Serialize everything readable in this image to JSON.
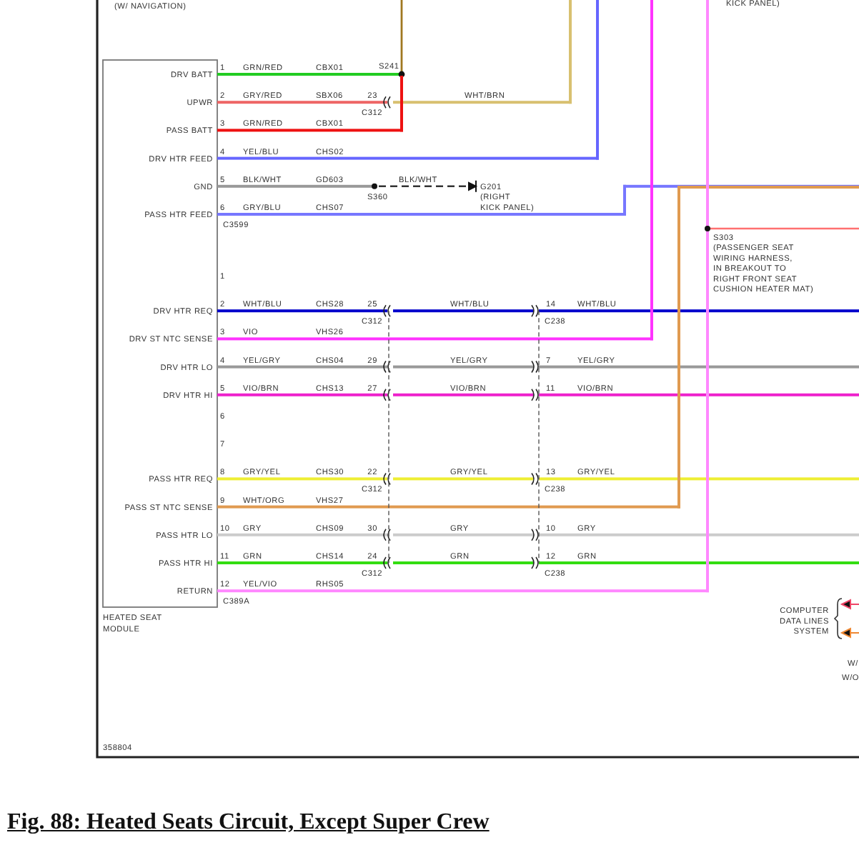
{
  "notes": {
    "top_left": "(W/ NAVIGATION)",
    "top_right": "KICK PANEL)"
  },
  "module": {
    "name_lines": [
      "HEATED SEAT",
      "MODULE"
    ]
  },
  "connectors": [
    {
      "name": "C3599",
      "pins": [
        {
          "pin": "1",
          "label": "DRV BATT",
          "wire": "GRN/RED",
          "circuit": "CBX01",
          "kind": "splice",
          "splice": "S241",
          "color": "#22cc22"
        },
        {
          "pin": "2",
          "label": "UPWR",
          "wire": "GRY/RED",
          "circuit": "SBX06",
          "kind": "inline_riser",
          "c312": {
            "cavity": "23",
            "connector": "C312"
          },
          "out": {
            "wire": "WHT/BRN",
            "color": "#d8c070"
          },
          "color": "#ee6666"
        },
        {
          "pin": "3",
          "label": "PASS BATT",
          "wire": "GRN/RED",
          "circuit": "CBX01",
          "kind": "splice_join",
          "color": "#ee1111"
        },
        {
          "pin": "4",
          "label": "DRV HTR FEED",
          "wire": "YEL/BLU",
          "circuit": "CHS02",
          "kind": "riser",
          "color": "#6666ff"
        },
        {
          "pin": "5",
          "label": "GND",
          "wire": "BLK/WHT",
          "circuit": "GD603",
          "kind": "ground",
          "splice": "S360",
          "out_wire": "BLK/WHT",
          "ground": [
            "G201",
            "(RIGHT",
            "KICK PANEL)"
          ],
          "color": "#999999"
        },
        {
          "pin": "6",
          "label": "PASS HTR FEED",
          "wire": "GRY/BLU",
          "circuit": "CHS07",
          "kind": "jog",
          "color": "#7777ff"
        }
      ]
    },
    {
      "name": "C389A",
      "pins": [
        {
          "pin": "1",
          "kind": "none"
        },
        {
          "pin": "2",
          "label": "DRV HTR REQ",
          "wire": "WHT/BLU",
          "circuit": "CHS28",
          "kind": "through",
          "c312": {
            "cavity": "25",
            "connector": "C312"
          },
          "out_wire": "WHT/BLU",
          "c238": {
            "cavity": "14",
            "connector": "C238"
          },
          "out2_wire": "WHT/BLU",
          "color": "#0000cc"
        },
        {
          "pin": "3",
          "label": "DRV ST NTC SENSE",
          "wire": "VIO",
          "circuit": "VHS26",
          "kind": "riser",
          "color": "#ff33ff"
        },
        {
          "pin": "4",
          "label": "DRV HTR LO",
          "wire": "YEL/GRY",
          "circuit": "CHS04",
          "kind": "through",
          "c312": {
            "cavity": "29"
          },
          "out_wire": "YEL/GRY",
          "c238": {
            "cavity": "7"
          },
          "out2_wire": "YEL/GRY",
          "color": "#999999"
        },
        {
          "pin": "5",
          "label": "DRV HTR HI",
          "wire": "VIO/BRN",
          "circuit": "CHS13",
          "kind": "through",
          "c312": {
            "cavity": "27"
          },
          "out_wire": "VIO/BRN",
          "c238": {
            "cavity": "11"
          },
          "out2_wire": "VIO/BRN",
          "color": "#ee22cc"
        },
        {
          "pin": "6",
          "kind": "none"
        },
        {
          "pin": "7",
          "kind": "none"
        },
        {
          "pin": "8",
          "label": "PASS HTR REQ",
          "wire": "GRY/YEL",
          "circuit": "CHS30",
          "kind": "through",
          "c312": {
            "cavity": "22",
            "connector": "C312"
          },
          "out_wire": "GRY/YEL",
          "c238": {
            "cavity": "13",
            "connector": "C238"
          },
          "out2_wire": "GRY/YEL",
          "color": "#eeee33"
        },
        {
          "pin": "9",
          "label": "PASS ST NTC SENSE",
          "wire": "WHT/ORG",
          "circuit": "VHS27",
          "kind": "box",
          "color": "#e09a50"
        },
        {
          "pin": "10",
          "label": "PASS HTR LO",
          "wire": "GRY",
          "circuit": "CHS09",
          "kind": "through",
          "c312": {
            "cavity": "30"
          },
          "out_wire": "GRY",
          "c238": {
            "cavity": "10"
          },
          "out2_wire": "GRY",
          "color": "#cccccc"
        },
        {
          "pin": "11",
          "label": "PASS HTR HI",
          "wire": "GRN",
          "circuit": "CHS14",
          "kind": "through",
          "c312": {
            "cavity": "24",
            "connector": "C312"
          },
          "out_wire": "GRN",
          "c238": {
            "cavity": "12",
            "connector": "C238"
          },
          "out2_wire": "GRN",
          "color": "#33dd11"
        },
        {
          "pin": "12",
          "label": "RETURN",
          "wire": "YEL/VIO",
          "circuit": "RHS05",
          "kind": "riser",
          "color": "#ff88ff"
        }
      ]
    }
  ],
  "splice_s303": {
    "label": "S303",
    "note_lines": [
      "(PASSENGER SEAT",
      "WIRING HARNESS,",
      "IN BREAKOUT TO",
      "RIGHT FRONT SEAT",
      "CUSHION HEATER MAT)"
    ]
  },
  "data_lines": {
    "label_lines": [
      "COMPUTER",
      "DATA LINES",
      "SYSTEM"
    ]
  },
  "right_edge": [
    "W/",
    "W/O"
  ],
  "drawing_number": "358804",
  "caption": "Fig. 88: Heated Seats Circuit, Except Super Crew"
}
